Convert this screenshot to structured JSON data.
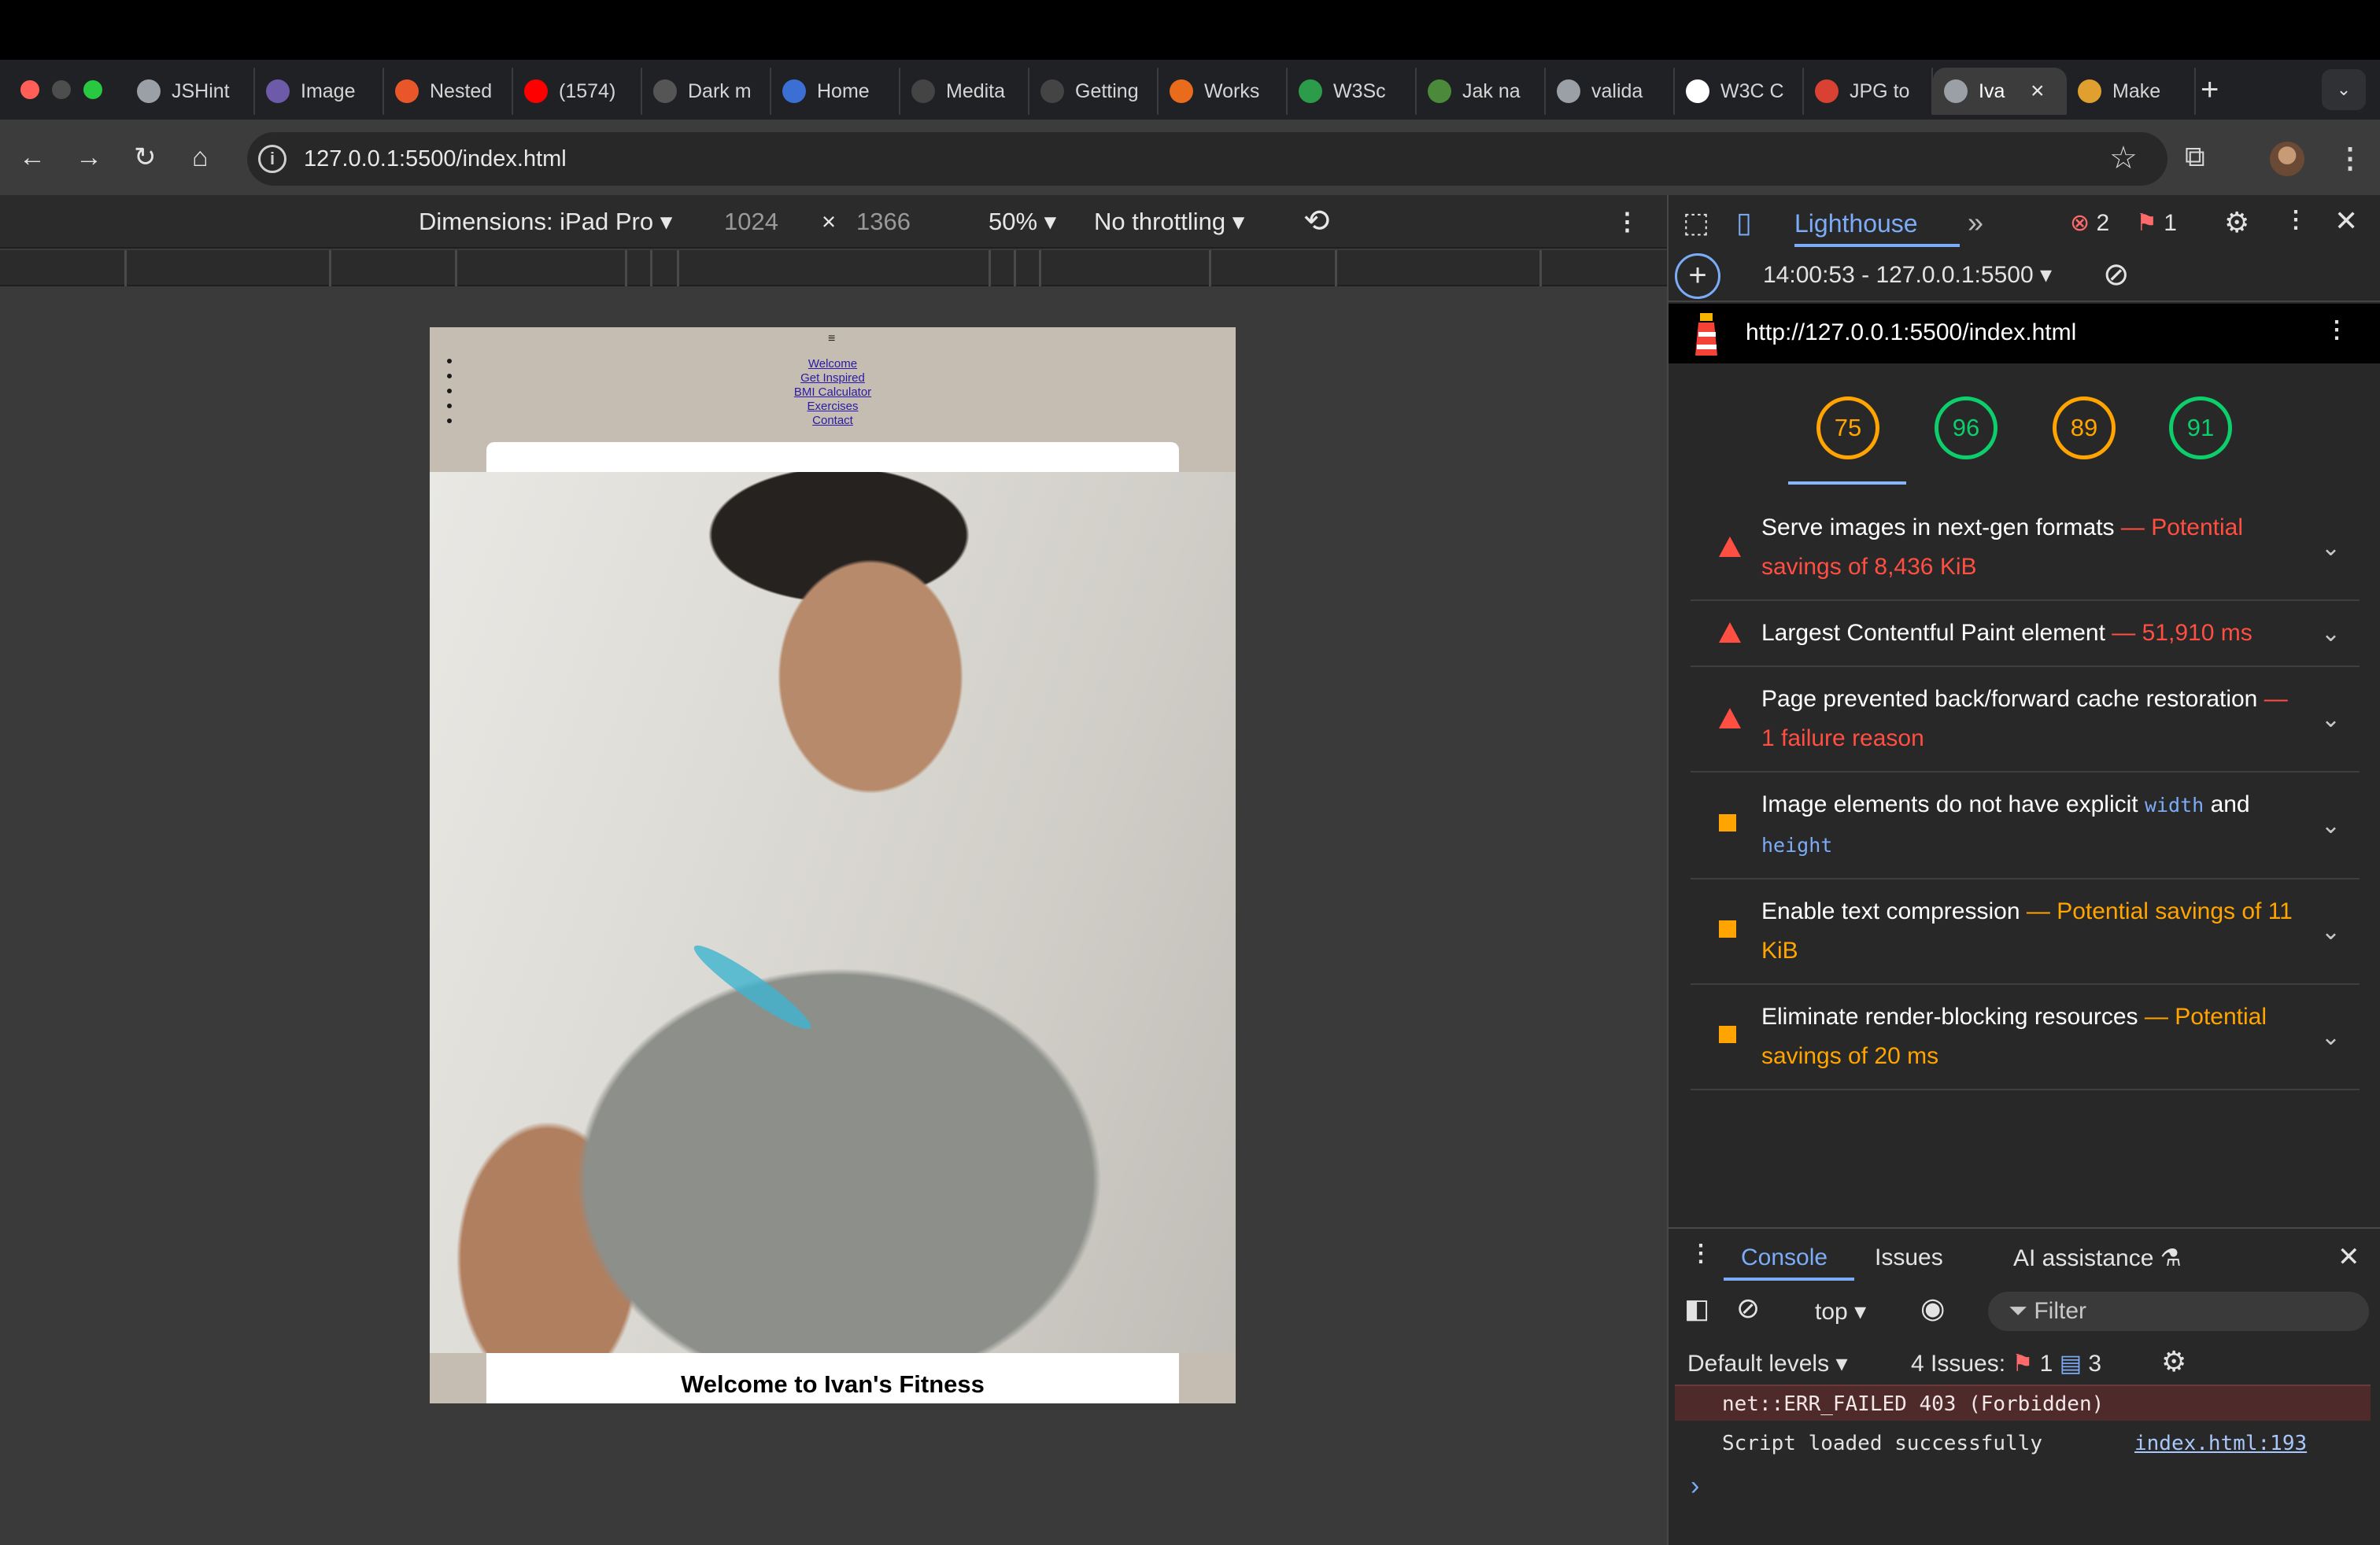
{
  "browser": {
    "tabs": [
      {
        "title": "JSHint",
        "icon": "globe-icon",
        "color": "#9aa0a6"
      },
      {
        "title": "Image",
        "icon": "app-icon",
        "color": "#6d5aa8"
      },
      {
        "title": "Nested",
        "icon": "ring-icon",
        "color": "#e8562a"
      },
      {
        "title": "(1574)",
        "icon": "youtube-icon",
        "color": "#ff0000"
      },
      {
        "title": "Dark m",
        "icon": "openai-icon",
        "color": "#555555"
      },
      {
        "title": "Home",
        "icon": "code-icon",
        "color": "#3b6fd4"
      },
      {
        "title": "Medita",
        "icon": "github-icon",
        "color": "#444444"
      },
      {
        "title": "Getting",
        "icon": "github-icon",
        "color": "#444444"
      },
      {
        "title": "Works",
        "icon": "g-icon",
        "color": "#e96b1b"
      },
      {
        "title": "W3Sc",
        "icon": "w-icon",
        "color": "#2c9c4a"
      },
      {
        "title": "Jak na",
        "icon": "tool-icon",
        "color": "#4a8a3a"
      },
      {
        "title": "valida",
        "icon": "globe-icon",
        "color": "#9aa0a6"
      },
      {
        "title": "W3C C",
        "icon": "w3c-icon",
        "color": "#ffffff"
      },
      {
        "title": "JPG to",
        "icon": "jpg-icon",
        "color": "#d94133"
      },
      {
        "title": "Iva",
        "icon": "globe-icon",
        "color": "#9aa0a6",
        "active": true
      },
      {
        "title": "Make",
        "icon": "avatar-icon",
        "color": "#e0a030"
      }
    ],
    "url": "127.0.0.1:5500/index.html"
  },
  "device_toolbar": {
    "dimensions_label": "Dimensions: iPad Pro",
    "width": "1024",
    "height": "1366",
    "times": "×",
    "zoom": "50%",
    "throttling": "No throttling"
  },
  "emulated_page": {
    "menu_glyph": "≡",
    "nav": [
      "Welcome",
      "Get Inspired",
      "BMI Calculator",
      "Exercises",
      "Contact"
    ],
    "heading": "Welcome to Ivan's Fitness"
  },
  "devtools": {
    "panel": "Lighthouse",
    "errors": "2",
    "warnings": "1",
    "report": "14:00:53 - 127.0.0.1:5500",
    "report_url": "http://127.0.0.1:5500/index.html",
    "scores": [
      {
        "value": "75",
        "color": "#ffa400"
      },
      {
        "value": "96",
        "color": "#0cce6b"
      },
      {
        "value": "89",
        "color": "#ffa400"
      },
      {
        "value": "91",
        "color": "#0cce6b"
      }
    ],
    "audits": [
      {
        "severity": "fail",
        "title": "Serve images in next-gen formats",
        "detail": "Potential savings of 8,436 KiB"
      },
      {
        "severity": "fail",
        "title": "Largest Contentful Paint element",
        "detail": "51,910 ms"
      },
      {
        "severity": "fail",
        "title": "Page prevented back/forward cache restoration",
        "detail": "1 failure reason"
      },
      {
        "severity": "average",
        "title": "Image elements do not have explicit",
        "code1": "width",
        "and": "and",
        "code2": "height"
      },
      {
        "severity": "average",
        "title": "Enable text compression",
        "detail": "Potential savings of 11 KiB"
      },
      {
        "severity": "average",
        "title": "Eliminate render-blocking resources",
        "detail": "Potential savings of 20 ms"
      }
    ],
    "dash": "—",
    "drawer": {
      "tabs": [
        "Console",
        "Issues",
        "AI assistance"
      ],
      "context": "top",
      "filter_placeholder": "Filter",
      "levels": "Default levels",
      "issues_label": "4 Issues:",
      "issues_errors": "1",
      "issues_info": "3",
      "log": [
        {
          "text": "net::ERR_FAILED 403 (Forbidden)",
          "type": "error"
        },
        {
          "text": "Script loaded successfully",
          "source": "index.html:193",
          "type": "log"
        }
      ],
      "prompt": "›"
    }
  }
}
